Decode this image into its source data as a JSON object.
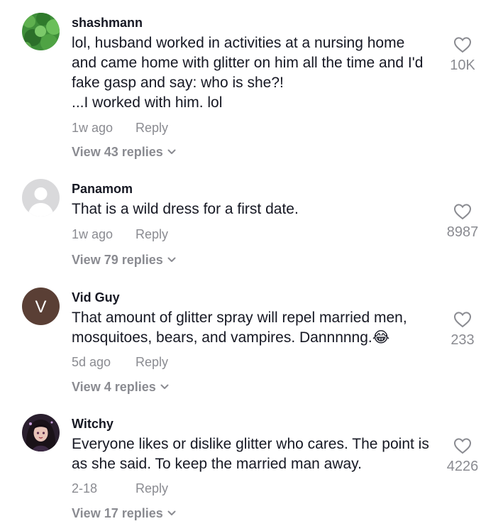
{
  "comments": [
    {
      "username": "shashmann",
      "text": "lol, husband worked in activities at a nursing home and came home with glitter on him all the time and I'd fake gasp and say: who is she?!\n...I worked with him. lol",
      "time": "1w ago",
      "reply_label": "Reply",
      "view_replies": "View 43 replies",
      "likes": "10K",
      "avatar": "green-foliage"
    },
    {
      "username": "Panamom",
      "text": "That is a wild dress for a first date.",
      "time": "1w ago",
      "reply_label": "Reply",
      "view_replies": "View 79 replies",
      "likes": "8987",
      "avatar": "default-person"
    },
    {
      "username": "Vid Guy",
      "text": "That amount of glitter spray will repel married men, mosquitoes, bears, and vampires. Dannnnng.😂",
      "time": "5d ago",
      "reply_label": "Reply",
      "view_replies": "View 4 replies",
      "likes": "233",
      "avatar_letter": "V",
      "avatar_color": "#5a3f35"
    },
    {
      "username": "Witchy",
      "text": "Everyone likes or dislike glitter who cares. The point is as she said. To keep the married man away.",
      "time": "2-18",
      "reply_label": "Reply",
      "view_replies": "View 17 replies",
      "likes": "4226",
      "avatar": "illustrated-portrait"
    }
  ],
  "colors": {
    "text_primary": "#161823",
    "text_secondary": "#8a8b91",
    "background": "#ffffff"
  }
}
